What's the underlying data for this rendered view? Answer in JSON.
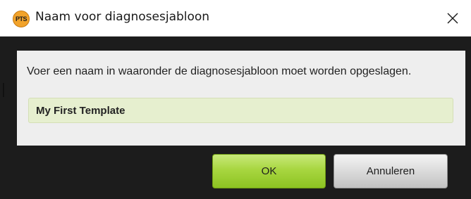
{
  "window": {
    "title": "Naam voor diagnosesjabloon",
    "app_icon_text": "PTS",
    "app_icon_color": "#f2a32b",
    "close_icon": "close-icon"
  },
  "dialog": {
    "message": "Voer een naam in waaronder de diagnosesjabloon moet worden opgeslagen.",
    "name_value": "My First Template",
    "input_color": "#e6efcf"
  },
  "buttons": {
    "ok_label": "OK",
    "ok_color": "#a8d640",
    "cancel_label": "Annuleren",
    "cancel_color": "#d8d8d8"
  }
}
